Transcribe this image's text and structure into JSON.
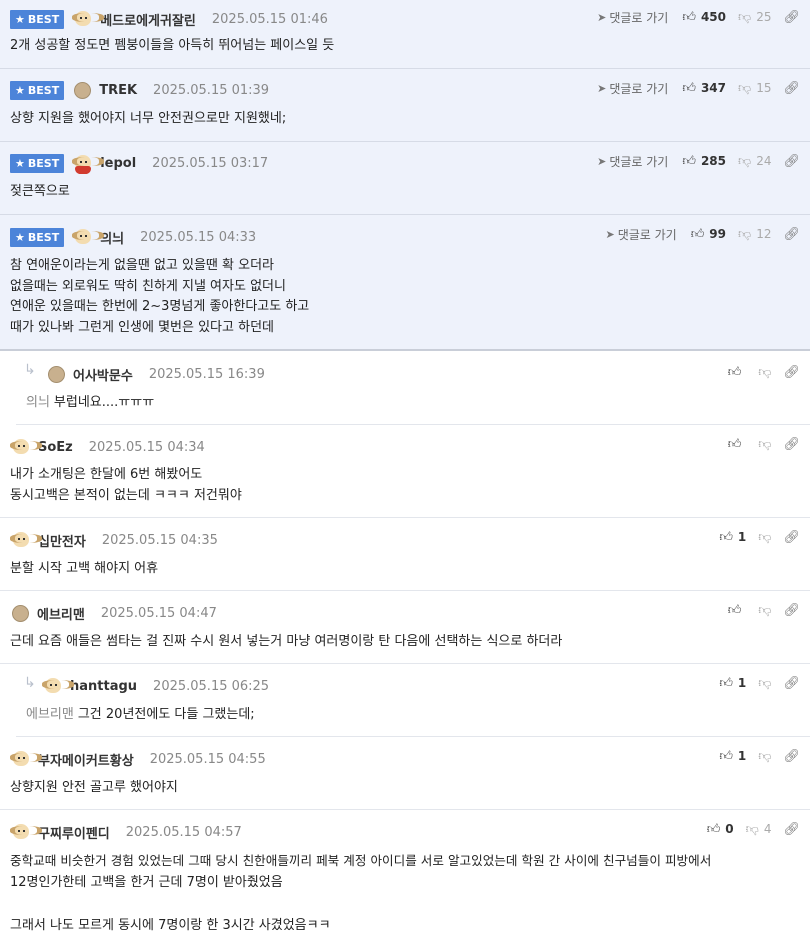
{
  "comments": [
    {
      "best": true,
      "badge": "BEST",
      "avatar": "dog-avatar",
      "nick": "베드로에게귀잘린",
      "date": "2025.05.15 01:46",
      "goto": "댓글로 가기",
      "likes": "450",
      "dislikes": "25",
      "lines": [
        "2개 성공할 정도면 펨붕이들을 아득히 뛰어넘는 페이스일 듯"
      ]
    },
    {
      "best": true,
      "badge": "BEST",
      "avatar": "circle-avatar",
      "nick": "TREK",
      "date": "2025.05.15 01:39",
      "goto": "댓글로 가기",
      "likes": "347",
      "dislikes": "15",
      "lines": [
        "상향 지원을 했어야지 너무 안전권으로만 지원했네;"
      ]
    },
    {
      "best": true,
      "badge": "BEST",
      "avatar": "red-dog-avatar",
      "nick": "lepol",
      "date": "2025.05.15 03:17",
      "goto": "댓글로 가기",
      "likes": "285",
      "dislikes": "24",
      "lines": [
        "젖큰쪽으로"
      ]
    },
    {
      "best": true,
      "badge": "BEST",
      "avatar": "dog-avatar",
      "nick": "의늬",
      "date": "2025.05.15 04:33",
      "goto": "댓글로 가기",
      "likes": "99",
      "dislikes": "12",
      "lines": [
        "참 연애운이라는게 없을땐 없고 있을땐 확 오더라",
        "없을때는 외로워도 딱히 친하게 지낼 여자도 없더니",
        "연애운 있을때는 한번에 2~3명넘게 좋아한다고도 하고",
        "때가 있나봐 그런게 인생에 몇번은 있다고 하던데"
      ]
    },
    {
      "reply": true,
      "avatar": "circle-avatar",
      "nick": "어사박문수",
      "date": "2025.05.15 16:39",
      "likes": "",
      "mention": "의늬",
      "lines": [
        "부럽네요....ㅠㅠㅠ"
      ]
    },
    {
      "avatar": "dog-avatar",
      "nick": "SoEz",
      "date": "2025.05.15 04:34",
      "likes": "",
      "lines": [
        "내가 소개팅은 한달에 6번 해봤어도",
        "동시고백은 본적이 없는데 ㅋㅋㅋ 저건뭐야"
      ]
    },
    {
      "avatar": "dog-avatar",
      "nick": "십만전자",
      "date": "2025.05.15 04:35",
      "likes": "1",
      "lines": [
        "분할 시작 고백 해야지 어휴"
      ]
    },
    {
      "avatar": "circle-avatar",
      "nick": "에브리맨",
      "date": "2025.05.15 04:47",
      "likes": "",
      "lines": [
        "근데 요즘 애들은 썸타는 걸 진짜 수시 원서 넣는거 마냥 여러명이랑 탄 다음에 선택하는 식으로 하더라"
      ]
    },
    {
      "reply": true,
      "avatar": "dog-avatar",
      "nick": "hanttagu",
      "date": "2025.05.15 06:25",
      "likes": "1",
      "mention": "에브리맨",
      "lines": [
        "그건 20년전에도 다들 그랬는데;"
      ]
    },
    {
      "avatar": "dog-avatar",
      "nick": "부자메이커트황상",
      "date": "2025.05.15 04:55",
      "likes": "1",
      "lines": [
        "상향지원 안전 골고루 했어야지"
      ]
    },
    {
      "avatar": "dog-avatar",
      "nick": "구찌루이펜디",
      "date": "2025.05.15 04:57",
      "likes": "0",
      "dislikes": "4",
      "lines": [
        "중학교때 비슷한거 경험 있었는데 그때 당시 친한애들끼리 페북 계정 아이디를 서로 알고있었는데 학원 간 사이에 친구넘들이 피방에서",
        "12명인가한테 고백을 한거 근데 7명이 받아줬었음",
        "",
        "그래서 나도 모르게 동시에 7명이랑 한 3시간 사겼었음ㅋㅋ"
      ]
    }
  ]
}
